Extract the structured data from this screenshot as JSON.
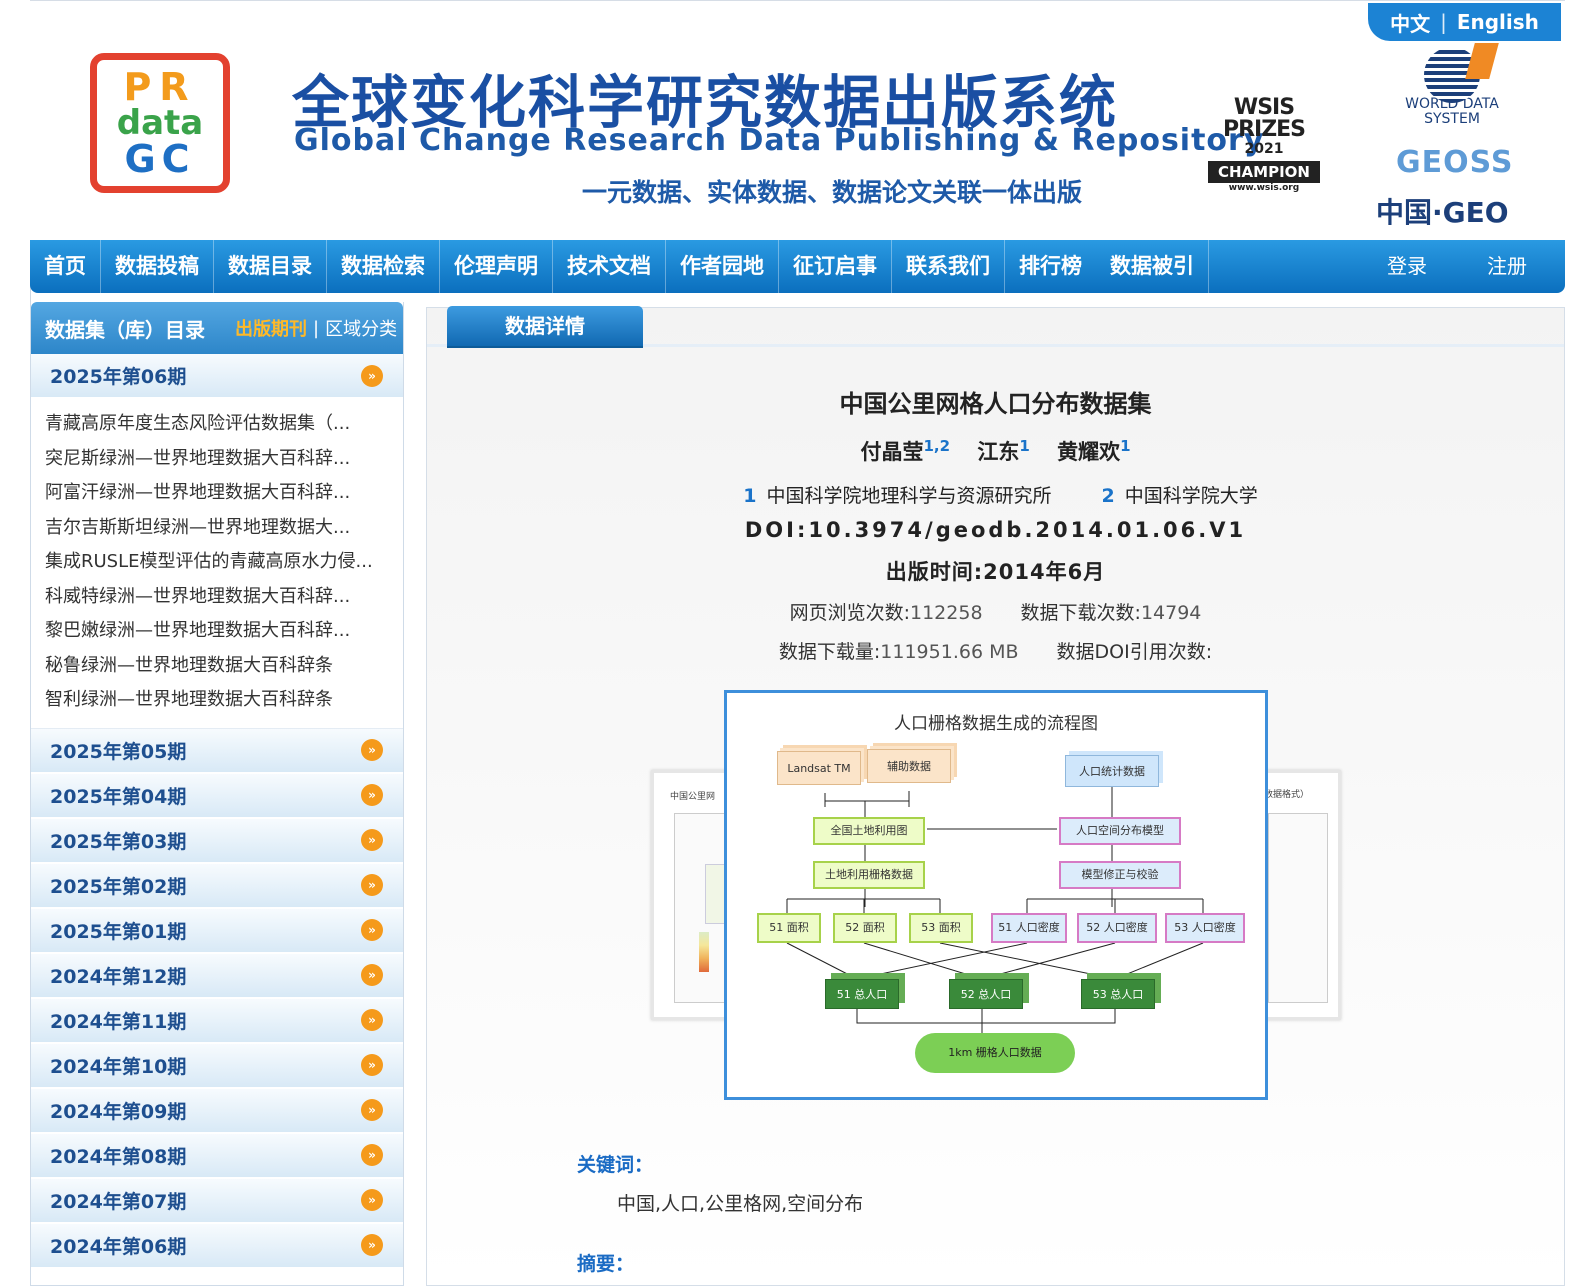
{
  "header": {
    "lang_zh": "中文",
    "lang_sep": "|",
    "lang_en": "English",
    "logo_line1": "PR",
    "logo_line2": "data",
    "logo_line3": "GC",
    "title_cn": "全球变化科学研究数据出版系统",
    "title_en": "Global Change Research Data Publishing & Repository",
    "tagline": "一元数据、实体数据、数据论文关联一体出版",
    "wsis_line1": "WSIS",
    "wsis_line2": "PRIZES",
    "wsis_year": "2021",
    "wsis_champion": "CHAMPION",
    "wsis_url": "www.wsis.org",
    "wds_text": "WORLD DATA SYSTEM",
    "geoss": "GEOSS",
    "cn_geo": "中国·GEO"
  },
  "nav": {
    "items": [
      "首页",
      "数据投稿",
      "数据目录",
      "数据检索",
      "伦理声明",
      "技术文档",
      "作者园地",
      "征订启事",
      "联系我们",
      "排行榜",
      "数据被引"
    ],
    "login": "登录",
    "register": "注册"
  },
  "sidebar": {
    "title": "数据集（库）目录",
    "tab_pub": "出版期刊",
    "sep": "|",
    "tab_region": "区域分类",
    "current_issue": "2025年第06期",
    "articles": [
      "青藏高原年度生态风险评估数据集（...",
      "突尼斯绿洲—世界地理数据大百科辞...",
      "阿富汗绿洲—世界地理数据大百科辞...",
      "吉尔吉斯斯坦绿洲—世界地理数据大...",
      "集成RUSLE模型评估的青藏高原水力侵...",
      "科威特绿洲—世界地理数据大百科辞...",
      "黎巴嫩绿洲—世界地理数据大百科辞...",
      "秘鲁绿洲—世界地理数据大百科辞条",
      "智利绿洲—世界地理数据大百科辞条"
    ],
    "issues": [
      "2025年第05期",
      "2025年第04期",
      "2025年第03期",
      "2025年第02期",
      "2025年第01期",
      "2024年第12期",
      "2024年第11期",
      "2024年第10期",
      "2024年第09期",
      "2024年第08期",
      "2024年第07期",
      "2024年第06期"
    ]
  },
  "main": {
    "tab": "数据详情",
    "title": "中国公里网格人口分布数据集",
    "authors": [
      {
        "name": "付晶莹",
        "aff": "1,2"
      },
      {
        "name": "江东",
        "aff": "1"
      },
      {
        "name": "黄耀欢",
        "aff": "1"
      }
    ],
    "affiliations": [
      {
        "n": "1",
        "name": "中国科学院地理科学与资源研究所"
      },
      {
        "n": "2",
        "name": "中国科学院大学"
      }
    ],
    "doi": "DOI:10.3974/geodb.2014.01.06.V1",
    "pub_date": "出版时间:2014年6月",
    "views_label": "网页浏览次数:",
    "views": "112258",
    "downloads_label": "数据下载次数:",
    "downloads": "14794",
    "volume_label": "数据下载量:",
    "volume": "111951.66 MB",
    "cite_label": "数据DOI引用次数:",
    "cite": "",
    "figure": {
      "title": "人口栅格数据生成的流程图",
      "left_caption": "中国公里网",
      "right_caption": "数据格式）",
      "nodes": {
        "landsat": "Landsat TM",
        "aux": "辅助数据",
        "stats": "人口统计数据",
        "landuse": "全国土地利用图",
        "model": "人口空间分布模型",
        "raster": "土地利用栅格数据",
        "correct": "模型修正与校验",
        "s1": "51 面积",
        "s2": "52 面积",
        "s3": "53 面积",
        "d1": "51 人口密度",
        "d2": "52 人口密度",
        "d3": "53 人口密度",
        "t1": "51 总人口",
        "t2": "52 总人口",
        "t3": "53 总人口",
        "final": "1km 栅格人口数据"
      }
    },
    "keywords_label": "关键词：",
    "keywords": "中国,人口,公里格网,空间分布",
    "abstract_label": "摘要："
  }
}
